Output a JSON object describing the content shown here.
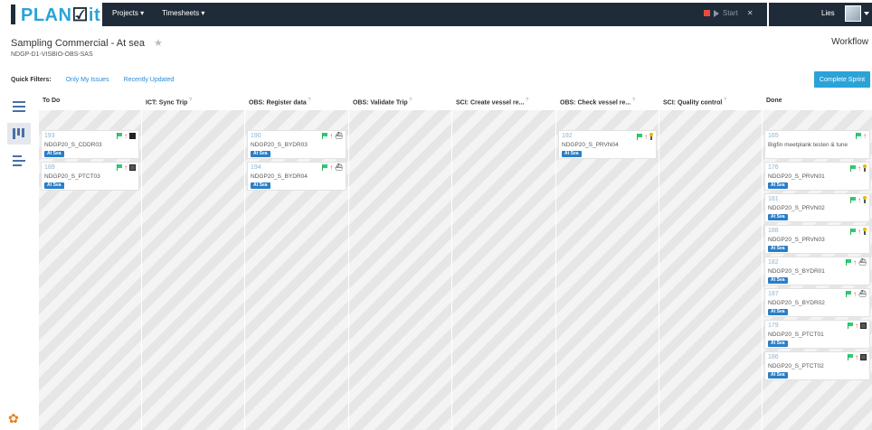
{
  "app": {
    "logo_text_a": "PLAN",
    "logo_text_b": "it",
    "nav": [
      "Projects ▾",
      "Timesheets ▾"
    ],
    "timer_label": "Start",
    "user_name": "Lies"
  },
  "board": {
    "title": "Sampling Commercial - At sea",
    "code": "NDGP-D1-VISBIO-OBS-SAS",
    "workflow_label": "Workflow"
  },
  "filters": {
    "label": "Quick Filters:",
    "items": [
      "Only My Issues",
      "Recently Updated"
    ]
  },
  "complete_sprint_label": "Complete Sprint",
  "colors": {
    "accent": "#2aa3d8",
    "topbar": "#1f2b38",
    "badge": "#2a7ec6",
    "flag": "#2ecc71",
    "priority": "#e74c3c"
  },
  "columns": [
    {
      "title": "To Do",
      "help": "",
      "cards": [
        {
          "key": "193",
          "summary": "NDGP20_S_CDDR03",
          "badge": "At Sea",
          "icon": "calculator-icon"
        },
        {
          "key": "189",
          "summary": "NDGP20_S_PTCT03",
          "badge": "At Sea",
          "icon": "calendar-icon"
        }
      ]
    },
    {
      "title": "ICT: Sync Trip",
      "help": "?",
      "cards": []
    },
    {
      "title": "OBS: Register data",
      "help": "?",
      "cards": [
        {
          "key": "190",
          "summary": "NDGP20_S_BYDR03",
          "badge": "At Sea",
          "icon": "ship-icon"
        },
        {
          "key": "194",
          "summary": "NDGP20_S_BYDR04",
          "badge": "At Sea",
          "icon": "ship-icon"
        }
      ]
    },
    {
      "title": "OBS: Validate Trip",
      "help": "?",
      "cards": []
    },
    {
      "title": "SCI: Create vessel re...",
      "help": "?",
      "cards": []
    },
    {
      "title": "OBS: Check vessel re...",
      "help": "?",
      "cards": [
        {
          "key": "192",
          "summary": "NDGP20_S_PRVN04",
          "badge": "At Sea",
          "icon": "pin-icon"
        }
      ]
    },
    {
      "title": "SCI: Quality control",
      "help": "?",
      "cards": []
    },
    {
      "title": "Done",
      "help": "",
      "cards": [
        {
          "key": "165",
          "summary": "Bigfin meetplank testen & tune",
          "badge": "",
          "icon": ""
        },
        {
          "key": "176",
          "summary": "NDGP20_S_PRVN01",
          "badge": "At Sea",
          "icon": "pin-icon"
        },
        {
          "key": "181",
          "summary": "NDGP20_S_PRVN02",
          "badge": "At Sea",
          "icon": "pin-icon"
        },
        {
          "key": "188",
          "summary": "NDGP20_S_PRVN03",
          "badge": "At Sea",
          "icon": "pin-icon"
        },
        {
          "key": "182",
          "summary": "NDGP20_S_BYDR01",
          "badge": "At Sea",
          "icon": "ship-icon"
        },
        {
          "key": "187",
          "summary": "NDGP20_S_BYDR02",
          "badge": "At Sea",
          "icon": "ship-icon"
        },
        {
          "key": "179",
          "summary": "NDGP20_S_PTCT01",
          "badge": "At Sea",
          "icon": "calendar-icon"
        },
        {
          "key": "186",
          "summary": "NDGP20_S_PTCT02",
          "badge": "At Sea",
          "icon": "calendar-icon"
        }
      ]
    }
  ]
}
